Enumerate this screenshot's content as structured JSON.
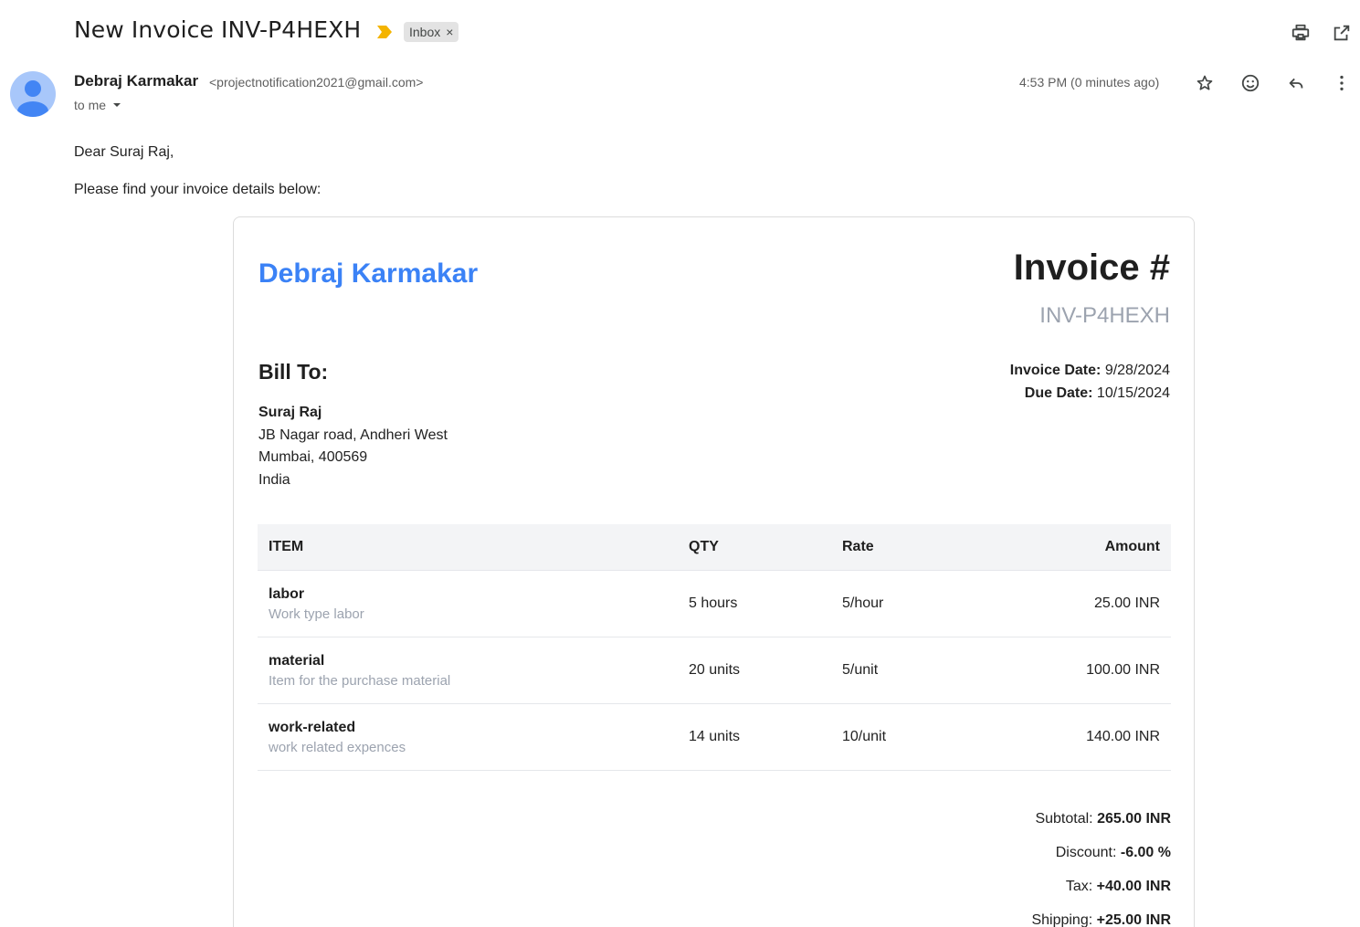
{
  "email": {
    "subject": "New Invoice INV-P4HEXH",
    "label_chip": "Inbox",
    "sender_name": "Debraj Karmakar",
    "sender_email": "<projectnotification2021@gmail.com>",
    "recipient": "to me",
    "timestamp": "4:53 PM (0 minutes ago)",
    "greeting": "Dear Suraj Raj,",
    "intro": "Please find your invoice details below:"
  },
  "icons": {
    "important": "important-marker-icon",
    "print": "print-icon",
    "open_new_window": "open-in-new-window-icon",
    "star": "star-icon",
    "emoji": "emoji-reaction-icon",
    "reply": "reply-icon",
    "more": "more-vert-icon",
    "dropdown": "chevron-down-icon"
  },
  "colors": {
    "company_blue": "#3b82f6",
    "important_yellow": "#f4b400",
    "avatar_bg": "#a8c7fa",
    "avatar_fg": "#4285f4"
  },
  "invoice": {
    "company": "Debraj Karmakar",
    "heading": "Invoice #",
    "number": "INV-P4HEXH",
    "bill_to_label": "Bill To:",
    "client_name": "Suraj Raj",
    "client_address_line1": "JB Nagar road, Andheri West",
    "client_address_line2": "Mumbai, 400569",
    "client_country": "India",
    "invoice_date_label": "Invoice Date:",
    "invoice_date": "9/28/2024",
    "due_date_label": "Due Date:",
    "due_date": "10/15/2024",
    "columns": {
      "item": "ITEM",
      "qty": "QTY",
      "rate": "Rate",
      "amount": "Amount"
    },
    "items": [
      {
        "name": "labor",
        "description": "Work type labor",
        "qty": "5 hours",
        "rate": "5/hour",
        "amount": "25.00 INR"
      },
      {
        "name": "material",
        "description": "Item for the purchase material",
        "qty": "20 units",
        "rate": "5/unit",
        "amount": "100.00 INR"
      },
      {
        "name": "work-related",
        "description": "work related expences",
        "qty": "14 units",
        "rate": "10/unit",
        "amount": "140.00 INR"
      }
    ],
    "totals": {
      "subtotal_label": "Subtotal:",
      "subtotal": "265.00 INR",
      "discount_label": "Discount:",
      "discount": "-6.00 %",
      "tax_label": "Tax:",
      "tax": "+40.00 INR",
      "shipping_label": "Shipping:",
      "shipping": "+25.00 INR"
    }
  }
}
